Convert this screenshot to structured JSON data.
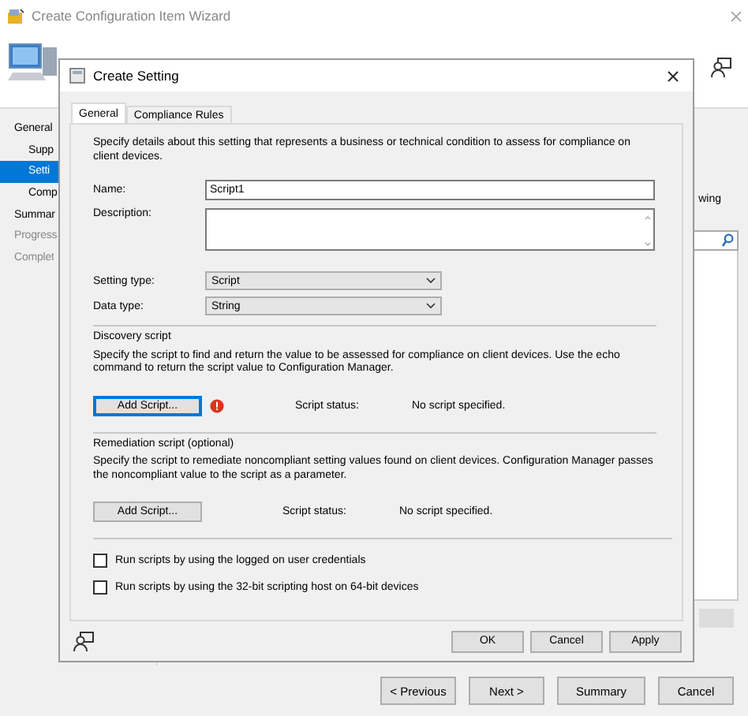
{
  "wizard": {
    "title": "Create Configuration Item Wizard",
    "nav": [
      {
        "label": "General",
        "selected": false,
        "disabled": false,
        "indent": false
      },
      {
        "label": "Supp",
        "selected": false,
        "disabled": false,
        "indent": true
      },
      {
        "label": "Setti",
        "selected": true,
        "disabled": false,
        "indent": true
      },
      {
        "label": "Comp",
        "selected": false,
        "disabled": false,
        "indent": true
      },
      {
        "label": "Summar",
        "selected": false,
        "disabled": false,
        "indent": false
      },
      {
        "label": "Progress",
        "selected": false,
        "disabled": true,
        "indent": false
      },
      {
        "label": "Complet",
        "selected": false,
        "disabled": true,
        "indent": false
      }
    ],
    "partial_text": "wing",
    "buttons": [
      "< Previous",
      "Next >",
      "Summary",
      "Cancel"
    ]
  },
  "dialog": {
    "title": "Create Setting",
    "tabs": [
      {
        "label": "General",
        "selected": true
      },
      {
        "label": "Compliance Rules",
        "selected": false
      }
    ],
    "intro": "Specify details about this setting that represents a business or technical condition to assess for compliance on client devices.",
    "name": {
      "label": "Name:",
      "value": "Script1"
    },
    "description": {
      "label": "Description:"
    },
    "setting_type": {
      "label": "Setting type:",
      "value": "Script"
    },
    "data_type": {
      "label": "Data type:",
      "value": "String"
    },
    "sections": [
      {
        "heading": "Discovery script",
        "text": "Specify the script to find and return the value to be assessed for compliance on client devices. Use the echo command to return the script value to Configuration Manager.",
        "button": "Add Script...",
        "focused": true,
        "warning": true,
        "status_label": "Script status:",
        "status_value": "No script specified."
      },
      {
        "heading": "Remediation script (optional)",
        "text": "Specify the script to remediate noncompliant setting values found on client devices. Configuration Manager passes the noncompliant value to the script as a parameter.",
        "button": "Add Script...",
        "focused": false,
        "warning": false,
        "status_label": "Script status:",
        "status_value": "No script specified."
      }
    ],
    "checkboxes": [
      {
        "label": "Run scripts by using the logged on user credentials",
        "checked": false
      },
      {
        "label": "Run scripts by using the 32-bit scripting host on 64-bit devices",
        "checked": false
      }
    ],
    "buttons": [
      "OK",
      "Cancel",
      "Apply"
    ]
  }
}
